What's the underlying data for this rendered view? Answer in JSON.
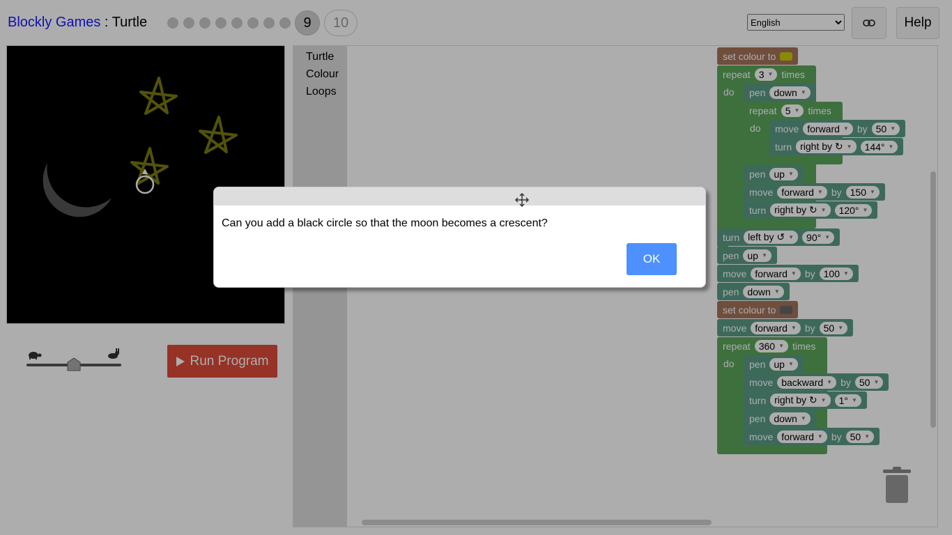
{
  "header": {
    "brand": "Blockly Games",
    "separator": " : ",
    "game": "Turtle",
    "current_level": "9",
    "next_level": "10",
    "language": "English",
    "help_label": "Help",
    "link_icon": "link-icon"
  },
  "controls": {
    "run_label": "Run Program",
    "speed_slow_icon": "turtle-icon",
    "speed_fast_icon": "rabbit-icon",
    "speed_level": 0.5
  },
  "toolbox": {
    "categories": [
      "Turtle",
      "Colour",
      "Loops"
    ]
  },
  "blocks": {
    "set_colour": "set colour to",
    "repeat": "repeat",
    "times": "times",
    "do": "do",
    "pen": "pen",
    "move": "move",
    "turn": "turn",
    "by": "by",
    "down": "down",
    "up": "up",
    "forward": "forward",
    "backward": "backward",
    "right_by": "right by ↻",
    "left_by": "left by ↺",
    "n3": "3",
    "n5": "5",
    "n50": "50",
    "a144": "144°",
    "n150": "150",
    "a120": "120°",
    "a90": "90°",
    "n100": "100",
    "n360": "360",
    "a1": "1°",
    "colour_yellow": "#ffff00",
    "colour_grey": "#666666"
  },
  "dialog": {
    "message": "Can you add a black circle so that the moon becomes a crescent?",
    "ok_label": "OK"
  },
  "colors": {
    "brand": "#1a1aff",
    "run_button": "#dd4b39",
    "ok_button": "#4d90fe",
    "turtle_blocks": "#5b9b87",
    "loop_blocks": "#5ba55b",
    "colour_blocks": "#a5745b"
  }
}
